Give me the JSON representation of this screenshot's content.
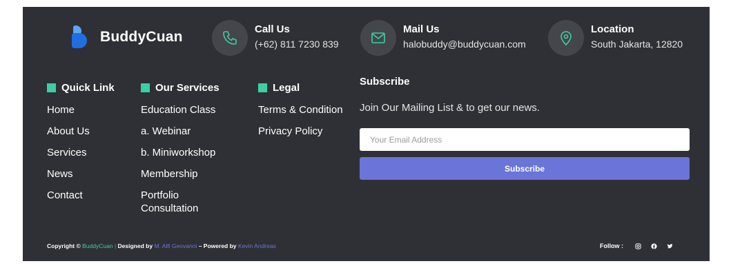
{
  "brand": {
    "name": "BuddyCuan"
  },
  "contacts": {
    "call": {
      "title": "Call Us",
      "value": "(+62) 811 7230 839"
    },
    "mail": {
      "title": "Mail Us",
      "value": "halobuddy@buddycuan.com"
    },
    "location": {
      "title": "Location",
      "value": "South Jakarta, 12820"
    }
  },
  "quick_link": {
    "title": "Quick Link",
    "items": [
      "Home",
      "About Us",
      "Services",
      "News",
      "Contact"
    ]
  },
  "services": {
    "title": "Our Services",
    "items": [
      "Education Class",
      "a. Webinar",
      "b. Miniworkshop",
      "Membership",
      "Portfolio Consultation"
    ]
  },
  "legal": {
    "title": "Legal",
    "items": [
      "Terms & Condition",
      "Privacy Policy"
    ]
  },
  "subscribe": {
    "title": "Subscribe",
    "text": "Join Our Mailing List & to get our news.",
    "placeholder": "Your Email Address",
    "button": "Subscribe"
  },
  "copyright": {
    "prefix": "Copyright ©",
    "brand": "BuddyCuan",
    "sep": "|",
    "designed_label": "Designed by",
    "designer": "M. Alfi Geovanni",
    "powered_label": "– Powered by",
    "powered_by": "Kevin Andreas"
  },
  "follow": {
    "label": "Follow :"
  },
  "colors": {
    "background": "#2f3035",
    "accent_green": "#3ccfa6",
    "accent_purple": "#6b74d8",
    "icon_circle": "#45464c"
  }
}
